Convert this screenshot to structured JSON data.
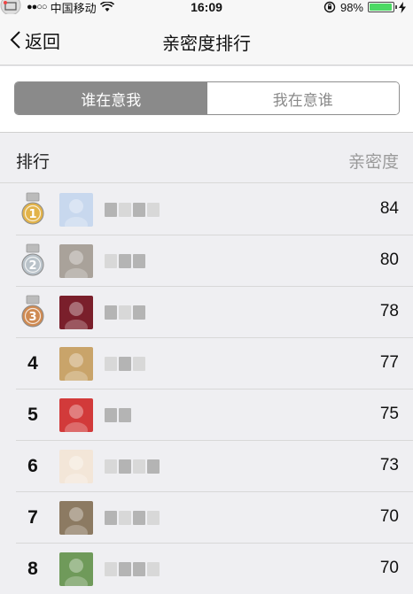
{
  "status_bar": {
    "dots": "●●○○",
    "carrier": "中国移动",
    "time": "16:09",
    "battery": "98%",
    "battery_level": 0.98
  },
  "nav": {
    "back_label": "返回",
    "title": "亲密度排行"
  },
  "segments": {
    "left": "谁在意我",
    "right": "我在意谁",
    "active": "left"
  },
  "list_header": {
    "rank": "排行",
    "score": "亲密度"
  },
  "rows": [
    {
      "rank": "1",
      "medal": "gold",
      "score": "84",
      "avatar_color": "#c8d8ee"
    },
    {
      "rank": "2",
      "medal": "silver",
      "score": "80",
      "avatar_color": "#a9a29a"
    },
    {
      "rank": "3",
      "medal": "bronze",
      "score": "78",
      "avatar_color": "#7a1f2b"
    },
    {
      "rank": "4",
      "medal": "",
      "score": "77",
      "avatar_color": "#c9a46a"
    },
    {
      "rank": "5",
      "medal": "",
      "score": "75",
      "avatar_color": "#d23a3a"
    },
    {
      "rank": "6",
      "medal": "",
      "score": "73",
      "avatar_color": "#f3e6d8"
    },
    {
      "rank": "7",
      "medal": "",
      "score": "70",
      "avatar_color": "#8c7a62"
    },
    {
      "rank": "8",
      "medal": "",
      "score": "70",
      "avatar_color": "#6f9a5a"
    }
  ],
  "colors": {
    "gold": "#e2b34a",
    "silver": "#b9c2c9",
    "bronze": "#cf8a52",
    "battery": "#4cd964",
    "segment_active": "#8a8a8a"
  }
}
